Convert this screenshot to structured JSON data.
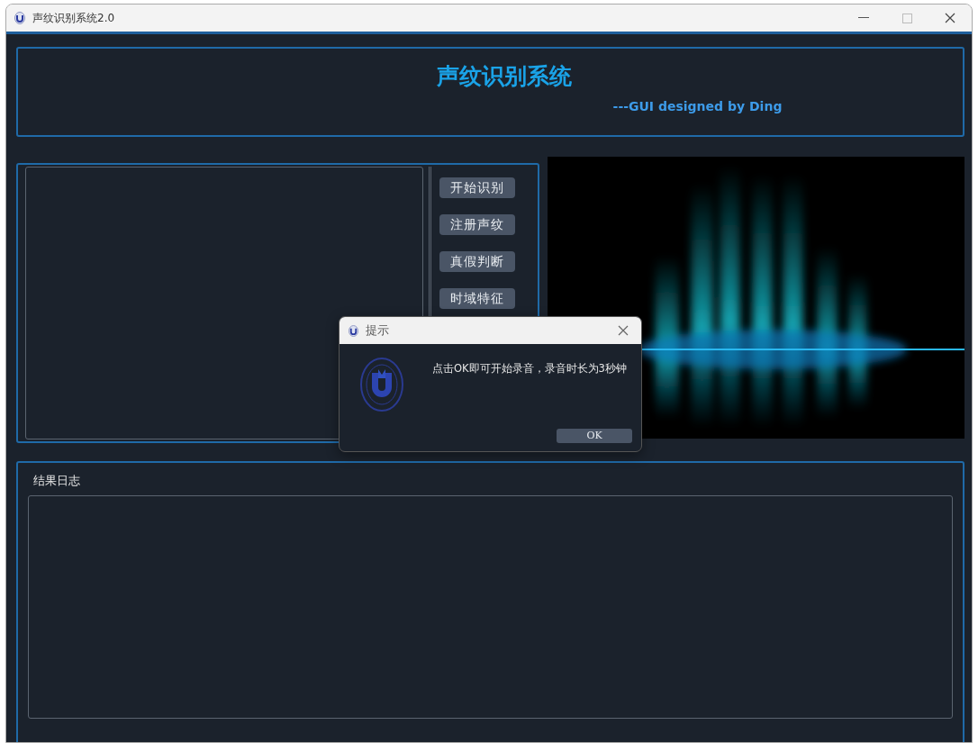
{
  "window": {
    "title": "声纹识别系统2.0"
  },
  "header": {
    "title": "声纹识别系统",
    "subtitle": "---GUI designed by Ding"
  },
  "buttons": [
    {
      "label": "开始识别"
    },
    {
      "label": "注册声纹"
    },
    {
      "label": "真假判断"
    },
    {
      "label": "时域特征"
    }
  ],
  "log": {
    "label": "结果日志"
  },
  "dialog": {
    "title": "提示",
    "message": "点击OK即可开始录音，录音时长为3秒钟",
    "button": "OK"
  }
}
